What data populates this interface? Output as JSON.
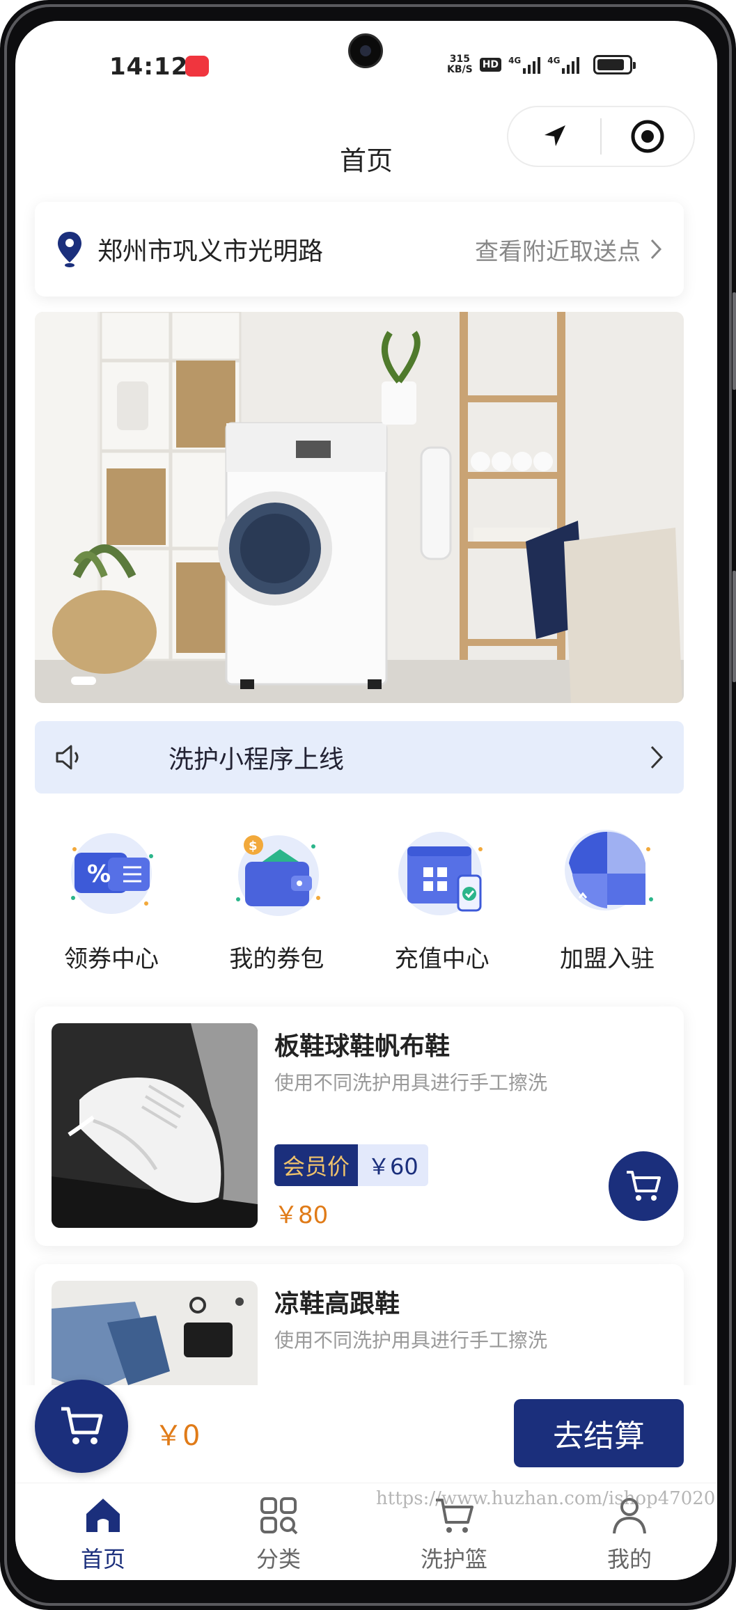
{
  "status_bar": {
    "time": "14:12",
    "net_speed_value": "315",
    "net_speed_unit": "KB/S",
    "hd": "HD",
    "sim1": "4G",
    "sim2": "4G"
  },
  "nav": {
    "title": "首页"
  },
  "location": {
    "address": "郑州市巩义市光明路",
    "nearby_link": "查看附近取送点"
  },
  "notice": {
    "text": "洗护小程序上线"
  },
  "menu": [
    {
      "label": "领券中心",
      "icon": "coupon-icon"
    },
    {
      "label": "我的券包",
      "icon": "wallet-icon"
    },
    {
      "label": "充值中心",
      "icon": "recharge-icon"
    },
    {
      "label": "加盟入驻",
      "icon": "puzzle-icon"
    }
  ],
  "products": [
    {
      "name": "板鞋球鞋帆布鞋",
      "desc": "使用不同洗护用具进行手工擦洗",
      "member_tag": "会员价",
      "member_price": "￥60",
      "price": "￥80"
    },
    {
      "name": "凉鞋高跟鞋",
      "desc": "使用不同洗护用具进行手工擦洗"
    }
  ],
  "cart": {
    "total": "￥0",
    "checkout_label": "去结算"
  },
  "tabs": [
    {
      "label": "首页",
      "icon": "home-icon"
    },
    {
      "label": "分类",
      "icon": "category-icon"
    },
    {
      "label": "洗护篮",
      "icon": "basket-icon"
    },
    {
      "label": "我的",
      "icon": "profile-icon"
    }
  ],
  "watermark": "https://www.huzhan.com/ishop47020",
  "colors": {
    "primary": "#1b2f7c",
    "price": "#e07b18",
    "notice_bg": "#e6edfb"
  }
}
